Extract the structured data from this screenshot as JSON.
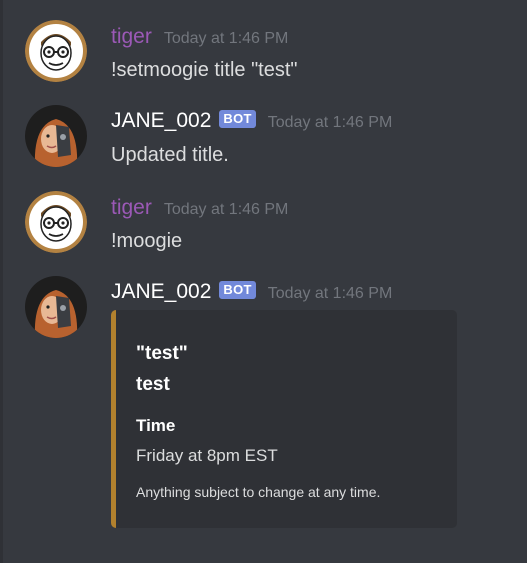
{
  "messages": [
    {
      "author": "tiger",
      "timestamp": "Today at 1:46 PM",
      "text": "!setmoogie title \"test\""
    },
    {
      "author": "JANE_002",
      "bot_tag": "BOT",
      "timestamp": "Today at 1:46 PM",
      "text": "Updated title."
    },
    {
      "author": "tiger",
      "timestamp": "Today at 1:46 PM",
      "text": "!moogie"
    },
    {
      "author": "JANE_002",
      "bot_tag": "BOT",
      "timestamp": "Today at 1:46 PM",
      "embed": {
        "author": "\"test\"",
        "title": "test",
        "field_name": "Time",
        "field_value": "Friday at 8pm EST",
        "footer": "Anything subject to change at any time."
      }
    }
  ],
  "colors": {
    "background": "#36393f",
    "tiger_name": "#9b59b6",
    "bot_tag": "#7289da",
    "embed_bar": "#b2812e",
    "embed_bg": "#2f3136",
    "timestamp": "#72767d"
  },
  "icons": {
    "tiger_avatar": "cartoon-face-with-glasses",
    "jane_avatar": "half-robot-woman-portrait"
  }
}
